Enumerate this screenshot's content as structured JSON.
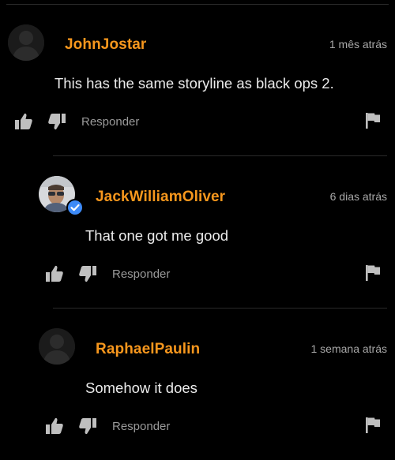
{
  "theme": {
    "background": "#000000",
    "username_color": "#f7971d",
    "verified_color": "#3d8af7",
    "divider_color": "#2a2a2a"
  },
  "comments": [
    {
      "username": "JohnJostar",
      "time": "1 mês atrás",
      "text": "This has the same storyline as black ops 2.",
      "reply_label": "Responder",
      "avatar": "default-avatar",
      "verified": false
    },
    {
      "username": "JackWilliamOliver",
      "time": "6 dias atrás",
      "text": "That one got me good",
      "reply_label": "Responder",
      "avatar": "user-photo",
      "verified": true
    },
    {
      "username": "RaphaelPaulin",
      "time": "1 semana atrás",
      "text": "Somehow it does",
      "reply_label": "Responder",
      "avatar": "default-avatar",
      "verified": false
    }
  ],
  "icons": {
    "like": "thumbs-up-icon",
    "dislike": "thumbs-down-icon",
    "report": "flag-icon",
    "verified": "checkmark-icon"
  }
}
